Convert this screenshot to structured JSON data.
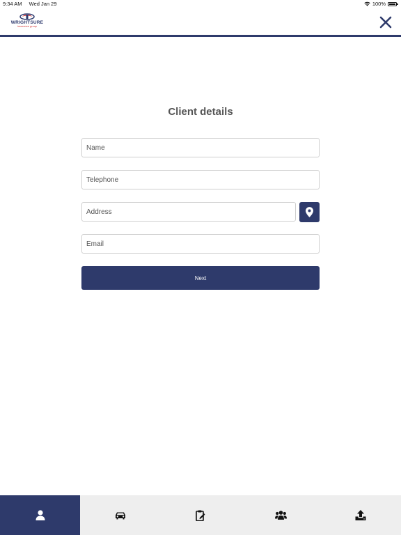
{
  "status_bar": {
    "time": "9:34 AM",
    "date": "Wed Jan 29",
    "battery": "100%",
    "battery_level": 1.0
  },
  "header": {
    "brand_name": "WRIGHTSURE",
    "brand_tagline": "insurance group",
    "close_icon": "close-icon",
    "accent_color": "#2e3a6b"
  },
  "form": {
    "title": "Client details",
    "name_placeholder": "Name",
    "telephone_placeholder": "Telephone",
    "address_placeholder": "Address",
    "email_placeholder": "Email",
    "location_icon": "map-pin-icon",
    "next_label": "Next"
  },
  "tab_bar": {
    "active_index": 0,
    "tabs": [
      {
        "icon": "user-icon"
      },
      {
        "icon": "car-icon"
      },
      {
        "icon": "clipboard-edit-icon"
      },
      {
        "icon": "users-icon"
      },
      {
        "icon": "upload-icon"
      }
    ]
  }
}
